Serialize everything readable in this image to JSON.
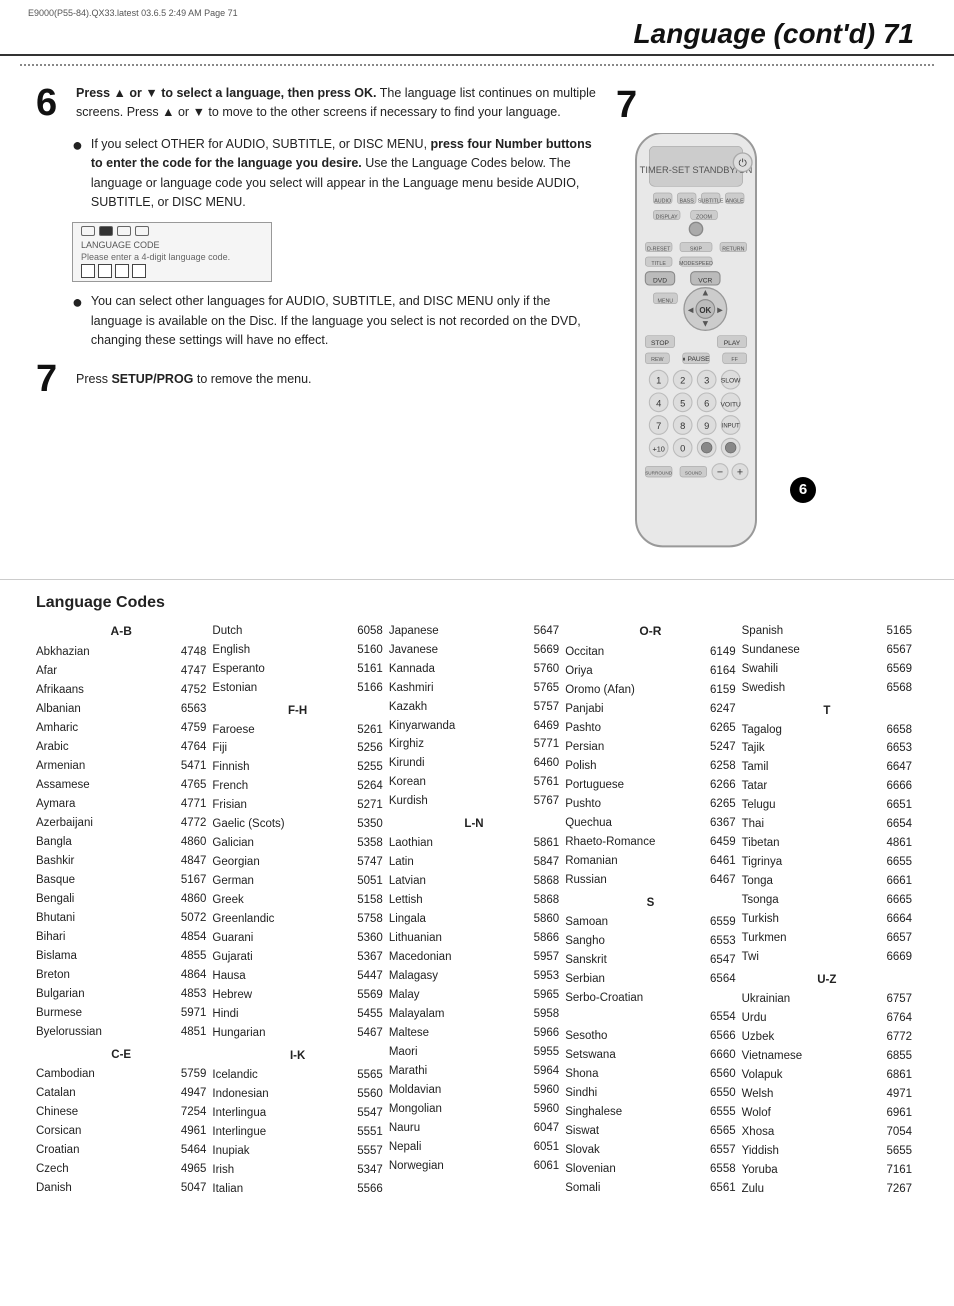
{
  "meta": {
    "file_info": "E9000(P55-84).QX33.latest  03.6.5 2:49 AM  Page 71"
  },
  "header": {
    "title": "Language (cont'd)  71"
  },
  "step6": {
    "number": "6",
    "text_main": "Press ▲ or ▼ to select a language, then press OK.",
    "text_body": " The language list continues on multiple screens. Press ▲ or ▼ to move to the other screens if necessary to find your language.",
    "bullet1_text": "If you select OTHER for AUDIO, SUBTITLE, or DISC MENU, ",
    "bullet1_bold": "press four Number buttons to enter the code for the language you desire.",
    "bullet1_rest": " Use the Language Codes below. The language or language code you select will appear in the Language menu beside AUDIO, SUBTITLE, or DISC MENU.",
    "bullet2_text": "You can select other languages for AUDIO, SUBTITLE, and DISC MENU only if the language is available on the Disc. If the language you select is not recorded on the DVD, changing these settings will have no effect."
  },
  "step7": {
    "number": "7",
    "text": "Press SETUP/PROG to remove the menu."
  },
  "lang_codes": {
    "title": "Language Codes",
    "columns": [
      {
        "header": "A-B",
        "entries": [
          {
            "name": "Abkhazian",
            "code": "4748"
          },
          {
            "name": "Afar",
            "code": "4747"
          },
          {
            "name": "Afrikaans",
            "code": "4752"
          },
          {
            "name": "Albanian",
            "code": "6563"
          },
          {
            "name": "Amharic",
            "code": "4759"
          },
          {
            "name": "Arabic",
            "code": "4764"
          },
          {
            "name": "Armenian",
            "code": "5471"
          },
          {
            "name": "Assamese",
            "code": "4765"
          },
          {
            "name": "Aymara",
            "code": "4771"
          },
          {
            "name": "Azerbaijani",
            "code": "4772"
          },
          {
            "name": "Bangla",
            "code": "4860"
          },
          {
            "name": "Bashkir",
            "code": "4847"
          },
          {
            "name": "Basque",
            "code": "5167"
          },
          {
            "name": "Bengali",
            "code": "4860"
          },
          {
            "name": "Bhutani",
            "code": "5072"
          },
          {
            "name": "Bihari",
            "code": "4854"
          },
          {
            "name": "Bislama",
            "code": "4855"
          },
          {
            "name": "Breton",
            "code": "4864"
          },
          {
            "name": "Bulgarian",
            "code": "4853"
          },
          {
            "name": "Burmese",
            "code": "5971"
          },
          {
            "name": "Byelorussian",
            "code": "4851"
          }
        ],
        "sub_header": "C-E",
        "sub_entries": [
          {
            "name": "Cambodian",
            "code": "5759"
          },
          {
            "name": "Catalan",
            "code": "4947"
          },
          {
            "name": "Chinese",
            "code": "7254"
          },
          {
            "name": "Corsican",
            "code": "4961"
          },
          {
            "name": "Croatian",
            "code": "5464"
          },
          {
            "name": "Czech",
            "code": "4965"
          },
          {
            "name": "Danish",
            "code": "5047"
          }
        ]
      },
      {
        "header": "",
        "entries": [
          {
            "name": "Dutch",
            "code": "6058"
          },
          {
            "name": "English",
            "code": "5160"
          },
          {
            "name": "Esperanto",
            "code": "5161"
          },
          {
            "name": "Estonian",
            "code": "5166"
          }
        ],
        "sub_header": "F-H",
        "sub_entries": [
          {
            "name": "Faroese",
            "code": "5261"
          },
          {
            "name": "Fiji",
            "code": "5256"
          },
          {
            "name": "Finnish",
            "code": "5255"
          },
          {
            "name": "French",
            "code": "5264"
          },
          {
            "name": "Frisian",
            "code": "5271"
          },
          {
            "name": "Gaelic (Scots)",
            "code": "5350"
          },
          {
            "name": "Galician",
            "code": "5358"
          },
          {
            "name": "Georgian",
            "code": "5747"
          },
          {
            "name": "German",
            "code": "5051"
          },
          {
            "name": "Greek",
            "code": "5158"
          },
          {
            "name": "Greenlandic",
            "code": "5758"
          },
          {
            "name": "Guarani",
            "code": "5360"
          },
          {
            "name": "Gujarati",
            "code": "5367"
          },
          {
            "name": "Hausa",
            "code": "5447"
          },
          {
            "name": "Hebrew",
            "code": "5569"
          },
          {
            "name": "Hindi",
            "code": "5455"
          },
          {
            "name": "Hungarian",
            "code": "5467"
          }
        ],
        "sub2_header": "I-K",
        "sub2_entries": [
          {
            "name": "Icelandic",
            "code": "5565"
          },
          {
            "name": "Indonesian",
            "code": "5560"
          },
          {
            "name": "Interlingua",
            "code": "5547"
          },
          {
            "name": "Interlingue",
            "code": "5551"
          },
          {
            "name": "Inupiak",
            "code": "5557"
          },
          {
            "name": "Irish",
            "code": "5347"
          },
          {
            "name": "Italian",
            "code": "5566"
          }
        ]
      },
      {
        "header": "",
        "entries": [
          {
            "name": "Japanese",
            "code": "5647"
          },
          {
            "name": "Javanese",
            "code": "5669"
          },
          {
            "name": "Kannada",
            "code": "5760"
          },
          {
            "name": "Kashmiri",
            "code": "5765"
          },
          {
            "name": "Kazakh",
            "code": "5757"
          },
          {
            "name": "Kinyarwanda",
            "code": "6469"
          },
          {
            "name": "Kirghiz",
            "code": "5771"
          },
          {
            "name": "Kirundi",
            "code": "6460"
          },
          {
            "name": "Korean",
            "code": "5761"
          },
          {
            "name": "Kurdish",
            "code": "5767"
          }
        ],
        "sub_header": "L-N",
        "sub_entries": [
          {
            "name": "Laothian",
            "code": "5861"
          },
          {
            "name": "Latin",
            "code": "5847"
          },
          {
            "name": "Latvian",
            "code": "5868"
          },
          {
            "name": "Lettish",
            "code": "5868"
          },
          {
            "name": "Lingala",
            "code": "5860"
          },
          {
            "name": "Lithuanian",
            "code": "5866"
          },
          {
            "name": "Macedonian",
            "code": "5957"
          },
          {
            "name": "Malagasy",
            "code": "5953"
          },
          {
            "name": "Malay",
            "code": "5965"
          },
          {
            "name": "Malayalam",
            "code": "5958"
          },
          {
            "name": "Maltese",
            "code": "5966"
          },
          {
            "name": "Maori",
            "code": "5955"
          },
          {
            "name": "Marathi",
            "code": "5964"
          },
          {
            "name": "Moldavian",
            "code": "5960"
          },
          {
            "name": "Mongolian",
            "code": "5960"
          },
          {
            "name": "Nauru",
            "code": "6047"
          },
          {
            "name": "Nepali",
            "code": "6051"
          },
          {
            "name": "Norwegian",
            "code": "6061"
          }
        ]
      },
      {
        "header": "O-R",
        "entries": [
          {
            "name": "Occitan",
            "code": "6149"
          },
          {
            "name": "Oriya",
            "code": "6164"
          },
          {
            "name": "Oromo (Afan)",
            "code": "6159"
          },
          {
            "name": "Panjabi",
            "code": "6247"
          },
          {
            "name": "Pashto",
            "code": "6265"
          },
          {
            "name": "Persian",
            "code": "5247"
          },
          {
            "name": "Polish",
            "code": "6258"
          },
          {
            "name": "Portuguese",
            "code": "6266"
          },
          {
            "name": "Pushto",
            "code": "6265"
          },
          {
            "name": "Quechua",
            "code": "6367"
          },
          {
            "name": "Rhaeto-Romance",
            "code": "6459"
          },
          {
            "name": "Romanian",
            "code": "6461"
          },
          {
            "name": "Russian",
            "code": "6467"
          }
        ],
        "sub_header": "S",
        "sub_entries": [
          {
            "name": "Samoan",
            "code": "6559"
          },
          {
            "name": "Sangho",
            "code": "6553"
          },
          {
            "name": "Sanskrit",
            "code": "6547"
          },
          {
            "name": "Serbian",
            "code": "6564"
          },
          {
            "name": "Serbo-Croatian",
            "code": ""
          },
          {
            "name": "",
            "code": "6554"
          },
          {
            "name": "Sesotho",
            "code": "6566"
          },
          {
            "name": "Setswana",
            "code": "6660"
          },
          {
            "name": "Shona",
            "code": "6560"
          },
          {
            "name": "Sindhi",
            "code": "6550"
          },
          {
            "name": "Singhalese",
            "code": "6555"
          },
          {
            "name": "Siswat",
            "code": "6565"
          },
          {
            "name": "Slovak",
            "code": "6557"
          },
          {
            "name": "Slovenian",
            "code": "6558"
          },
          {
            "name": "Somali",
            "code": "6561"
          }
        ]
      },
      {
        "header": "",
        "entries": [
          {
            "name": "Spanish",
            "code": "5165"
          },
          {
            "name": "Sundanese",
            "code": "6567"
          },
          {
            "name": "Swahili",
            "code": "6569"
          },
          {
            "name": "Swedish",
            "code": "6568"
          }
        ],
        "sub_header": "T",
        "sub_entries": [
          {
            "name": "Tagalog",
            "code": "6658"
          },
          {
            "name": "Tajik",
            "code": "6653"
          },
          {
            "name": "Tamil",
            "code": "6647"
          },
          {
            "name": "Tatar",
            "code": "6666"
          },
          {
            "name": "Telugu",
            "code": "6651"
          },
          {
            "name": "Thai",
            "code": "6654"
          },
          {
            "name": "Tibetan",
            "code": "4861"
          },
          {
            "name": "Tigrinya",
            "code": "6655"
          },
          {
            "name": "Tonga",
            "code": "6661"
          },
          {
            "name": "Tsonga",
            "code": "6665"
          },
          {
            "name": "Turkish",
            "code": "6664"
          },
          {
            "name": "Turkmen",
            "code": "6657"
          },
          {
            "name": "Twi",
            "code": "6669"
          }
        ],
        "sub2_header": "U-Z",
        "sub2_entries": [
          {
            "name": "Ukrainian",
            "code": "6757"
          },
          {
            "name": "Urdu",
            "code": "6764"
          },
          {
            "name": "Uzbek",
            "code": "6772"
          },
          {
            "name": "Vietnamese",
            "code": "6855"
          },
          {
            "name": "Volapuk",
            "code": "6861"
          },
          {
            "name": "Welsh",
            "code": "4971"
          },
          {
            "name": "Wolof",
            "code": "6961"
          },
          {
            "name": "Xhosa",
            "code": "7054"
          },
          {
            "name": "Yiddish",
            "code": "5655"
          },
          {
            "name": "Yoruba",
            "code": "7161"
          },
          {
            "name": "Zulu",
            "code": "7267"
          }
        ]
      }
    ]
  }
}
